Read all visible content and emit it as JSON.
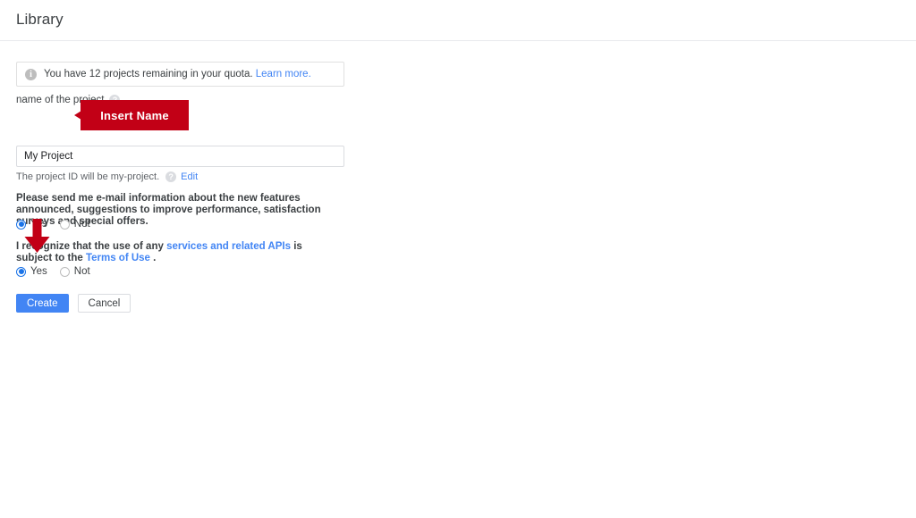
{
  "header": {
    "title": "Library"
  },
  "banner": {
    "icon": "info-icon",
    "icon_glyph": "i",
    "text": "You have 12 projects remaining in your quota.",
    "link_label": "Learn more.",
    "link_color": "#4285f4"
  },
  "form": {
    "project_name_label": "name of the project",
    "help_glyph": "?",
    "project_name_value": "My Project",
    "project_name_placeholder": "My Project",
    "project_id_hint": "The project ID will be my-project.",
    "edit_link_label": "Edit",
    "email_consent_text": "Please send me e-mail information about the new features announced, suggestions to improve performance, satisfaction surveys and special offers.",
    "email_consent_options": [
      {
        "label": "Yes",
        "selected": true
      },
      {
        "label": "Not",
        "selected": false
      }
    ],
    "terms_text_part1": "I recognize that the use of any ",
    "terms_link1": "services and related APIs",
    "terms_text_part2": " is subject to the ",
    "terms_link2": "Terms of Use",
    "terms_text_part3": " .",
    "terms_options": [
      {
        "label": "Yes",
        "selected": true
      },
      {
        "label": "Not",
        "selected": false
      }
    ]
  },
  "actions": {
    "create_label": "Create",
    "cancel_label": "Cancel",
    "primary_color": "#4285f4"
  },
  "annotations": {
    "callout_label": "Insert Name",
    "callout_color": "#c20016",
    "arrow_color": "#c20016",
    "arrow_name": "down-arrow-annotation"
  }
}
